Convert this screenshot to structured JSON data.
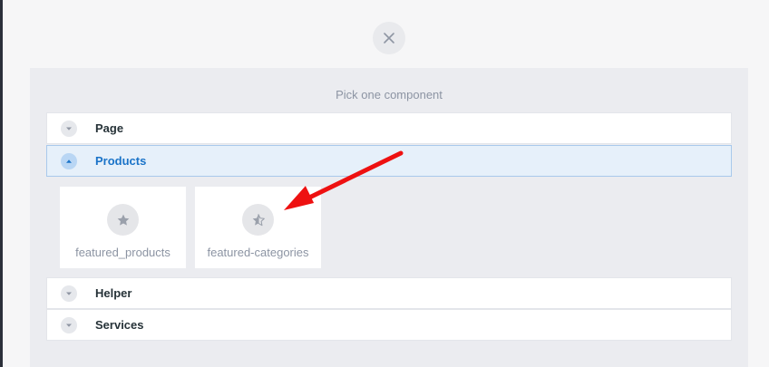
{
  "modal": {
    "close_icon": "close-icon",
    "title": "Pick one component"
  },
  "sections": [
    {
      "label": "Page",
      "expanded": false
    },
    {
      "label": "Products",
      "expanded": true
    },
    {
      "label": "Helper",
      "expanded": false
    },
    {
      "label": "Services",
      "expanded": false
    }
  ],
  "components": [
    {
      "label": "featured_products",
      "icon": "star-icon"
    },
    {
      "label": "featured-categories",
      "icon": "half-star-icon"
    }
  ],
  "colors": {
    "accent": "#1a73c8",
    "annotation_arrow": "#ee1111"
  }
}
